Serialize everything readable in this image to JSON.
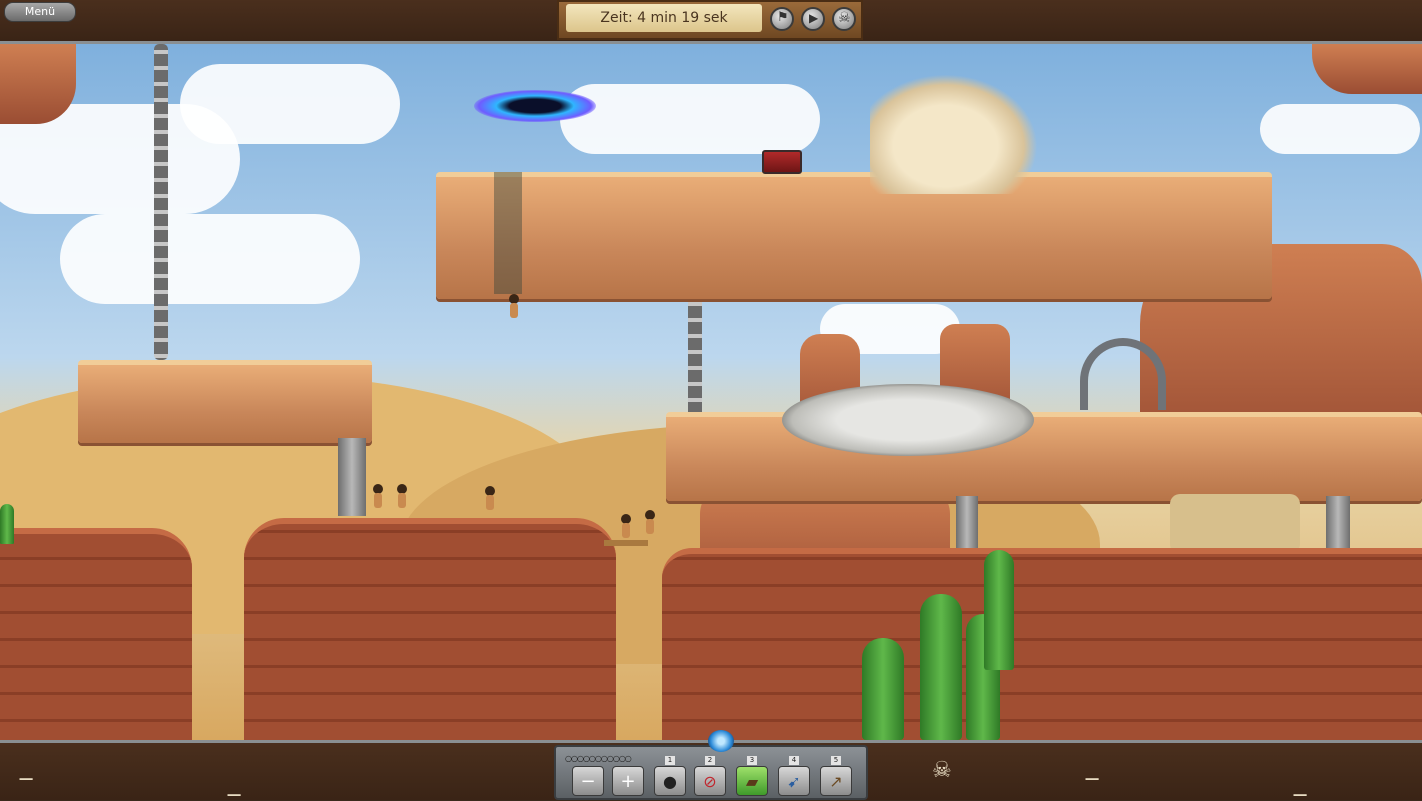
{
  "hud": {
    "menu_label": "Menü",
    "timer_text": "Zeit: 4 min 19 sek"
  },
  "top_buttons": [
    {
      "name": "restart-flag-icon",
      "glyph": "⚑"
    },
    {
      "name": "play-icon",
      "glyph": "▶"
    },
    {
      "name": "skull-icon",
      "glyph": "☠"
    }
  ],
  "toolbar": {
    "speed_dots": "○○○○○○○○○○○",
    "minus_label": "−",
    "plus_label": "+",
    "tools": [
      {
        "number": "1",
        "name": "bomb-icon",
        "glyph": "●"
      },
      {
        "number": "2",
        "name": "stop-sign-icon",
        "glyph": "⊘"
      },
      {
        "number": "3",
        "name": "bridge-plank-icon",
        "glyph": "▰"
      },
      {
        "number": "4",
        "name": "drill-icon",
        "glyph": "➹"
      },
      {
        "number": "5",
        "name": "spear-icon",
        "glyph": "↗"
      }
    ]
  },
  "colors": {
    "sky": "#7fb0dd",
    "sand": "#e2b870",
    "rock": "#a14e32",
    "wood": "#3a2416"
  }
}
